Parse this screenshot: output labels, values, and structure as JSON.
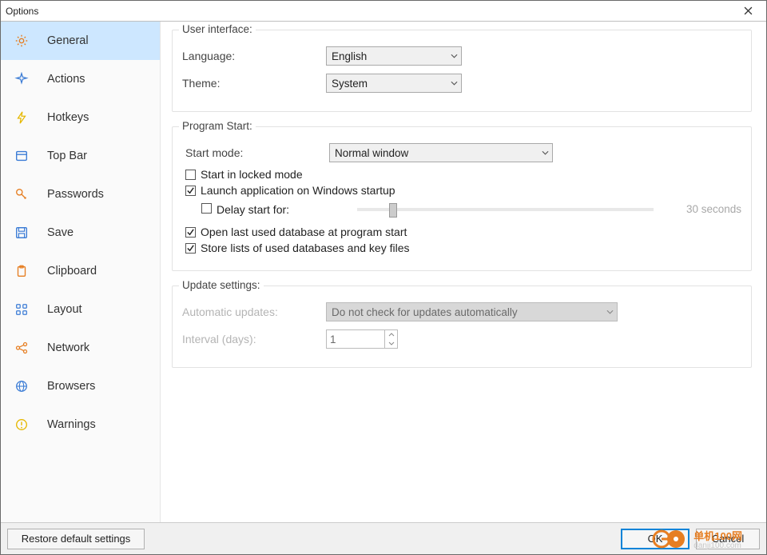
{
  "window": {
    "title": "Options"
  },
  "sidebar": {
    "items": [
      {
        "label": "General",
        "icon": "gear-icon",
        "color": "",
        "active": true
      },
      {
        "label": "Actions",
        "icon": "sparkle-icon",
        "color": "blue",
        "active": false
      },
      {
        "label": "Hotkeys",
        "icon": "bolt-icon",
        "color": "yellow",
        "active": false
      },
      {
        "label": "Top Bar",
        "icon": "topbar-icon",
        "color": "blue",
        "active": false
      },
      {
        "label": "Passwords",
        "icon": "key-icon",
        "color": "",
        "active": false
      },
      {
        "label": "Save",
        "icon": "save-icon",
        "color": "blue",
        "active": false
      },
      {
        "label": "Clipboard",
        "icon": "clipboard-icon",
        "color": "",
        "active": false
      },
      {
        "label": "Layout",
        "icon": "grid-icon",
        "color": "blue",
        "active": false
      },
      {
        "label": "Network",
        "icon": "share-icon",
        "color": "",
        "active": false
      },
      {
        "label": "Browsers",
        "icon": "globe-icon",
        "color": "blue",
        "active": false
      },
      {
        "label": "Warnings",
        "icon": "warning-icon",
        "color": "yellow",
        "active": false
      }
    ]
  },
  "groups": {
    "ui": {
      "legend": "User interface:",
      "language_label": "Language:",
      "language_value": "English",
      "theme_label": "Theme:",
      "theme_value": "System"
    },
    "start": {
      "legend": "Program Start:",
      "mode_label": "Start mode:",
      "mode_value": "Normal window",
      "locked": {
        "label": "Start in locked mode",
        "checked": false
      },
      "autostart": {
        "label": "Launch application on Windows startup",
        "checked": true
      },
      "delay": {
        "label": "Delay start for:",
        "checked": false,
        "value_text": "30 seconds"
      },
      "open_last": {
        "label": "Open last used database at program start",
        "checked": true
      },
      "store_lists": {
        "label": "Store lists of used databases and key files",
        "checked": true
      }
    },
    "update": {
      "legend": "Update settings:",
      "auto_label": "Automatic updates:",
      "auto_value": "Do not check for updates automatically",
      "interval_label": "Interval (days):",
      "interval_value": "1"
    }
  },
  "footer": {
    "restore": "Restore default settings",
    "ok": "OK",
    "cancel": "Cancel"
  },
  "watermark": {
    "brand": "单机100网",
    "domain": "danji100.com"
  }
}
